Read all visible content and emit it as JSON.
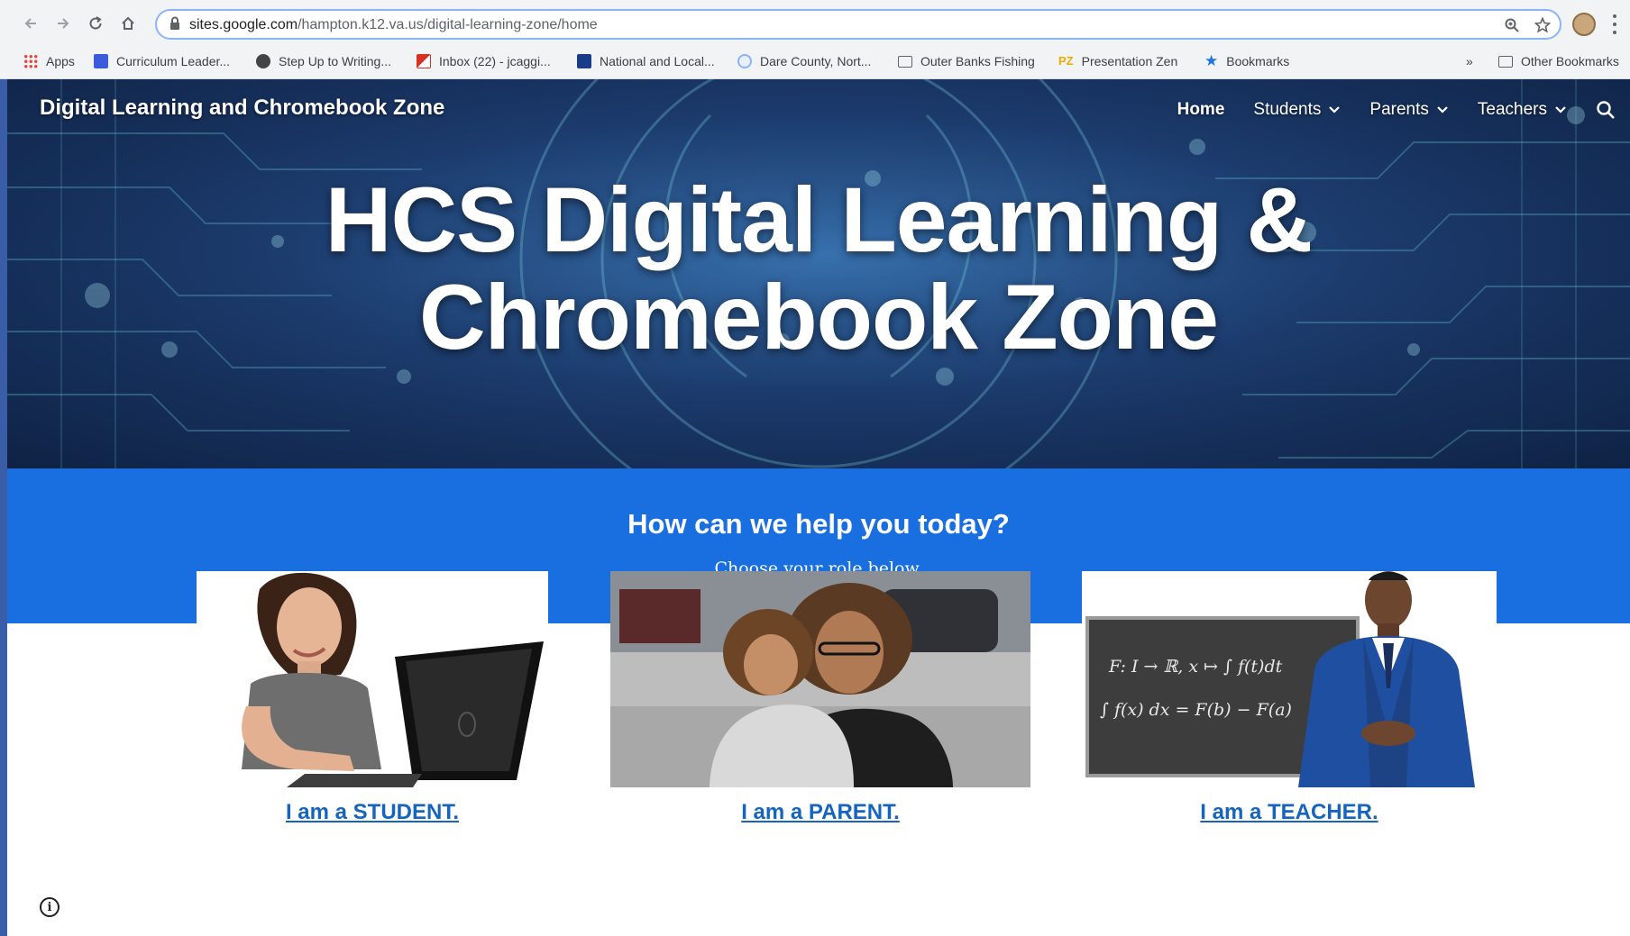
{
  "browser": {
    "url_host": "sites.google.com",
    "url_path": "/hampton.k12.va.us/digital-learning-zone/home",
    "bookmarks": [
      {
        "label": "Apps",
        "icon": "apps-grid-icon",
        "color": "#e8453c"
      },
      {
        "label": "Curriculum Leader...",
        "icon": "site-icon",
        "color": "#3b5bdb"
      },
      {
        "label": "Step Up to Writing...",
        "icon": "globe-icon",
        "color": "#444444"
      },
      {
        "label": "Inbox (22) - jcaggi...",
        "icon": "gmail-icon",
        "color": "#d93025"
      },
      {
        "label": "National and Local...",
        "icon": "weather-icon",
        "color": "#1a3a8a"
      },
      {
        "label": "Dare County, Nort...",
        "icon": "county-seal-icon",
        "color": "#8ab4f8"
      },
      {
        "label": "Outer Banks Fishing",
        "icon": "folder-icon",
        "color": "#5f6368"
      },
      {
        "label": "Presentation Zen",
        "icon": "pz-icon",
        "color": "#f2a900"
      },
      {
        "label": "Bookmarks",
        "icon": "star-icon",
        "color": "#1a73e8"
      }
    ],
    "overflow": "»",
    "other_bookmarks": "Other Bookmarks"
  },
  "site": {
    "title": "Digital Learning and Chromebook Zone",
    "nav": [
      {
        "label": "Home",
        "active": true,
        "dropdown": false
      },
      {
        "label": "Students",
        "active": false,
        "dropdown": true
      },
      {
        "label": "Parents",
        "active": false,
        "dropdown": true
      },
      {
        "label": "Teachers",
        "active": false,
        "dropdown": true
      }
    ],
    "hero_line1": "HCS Digital Learning &",
    "hero_line2": "Chromebook Zone"
  },
  "help": {
    "title": "How can we help you today?",
    "subtitle": "Choose your role below."
  },
  "roles": [
    {
      "label": "I am a STUDENT."
    },
    {
      "label": "I am a PARENT."
    },
    {
      "label": "I am a TEACHER."
    }
  ],
  "chalkboard": {
    "line1": "F: I → ℝ, x ↦ ∫ f(t)dt",
    "line2": "∫ f(x) dx = F(b) − F(a)"
  },
  "info_glyph": "i",
  "colors": {
    "help_band": "#1a6fe0",
    "link": "#1565c0",
    "hero_dark": "#0f2244"
  }
}
